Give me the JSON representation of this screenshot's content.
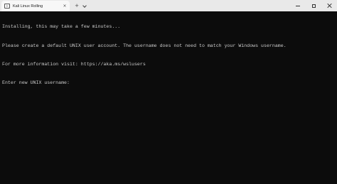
{
  "window": {
    "tab_title": "Kali Linux Rolling",
    "tab_close": "×",
    "new_tab": "+"
  },
  "terminal": {
    "lines": [
      "Installing, this may take a few minutes...",
      "Please create a default UNIX user account. The username does not need to match your Windows username.",
      "For more information visit: https://aka.ms/wslusers",
      "Enter new UNIX username:"
    ],
    "input_value": ""
  },
  "colors": {
    "terminal_background": "#0c0c0c",
    "terminal_text": "#cccccc",
    "titlebar": "#e9e9e9",
    "tab_active": "#f7f7f7"
  },
  "icons": {
    "tab": "terminal-icon",
    "dropdown": "chevron-down-icon",
    "minimize": "minimize-icon",
    "maximize": "maximize-icon",
    "close": "close-icon"
  }
}
